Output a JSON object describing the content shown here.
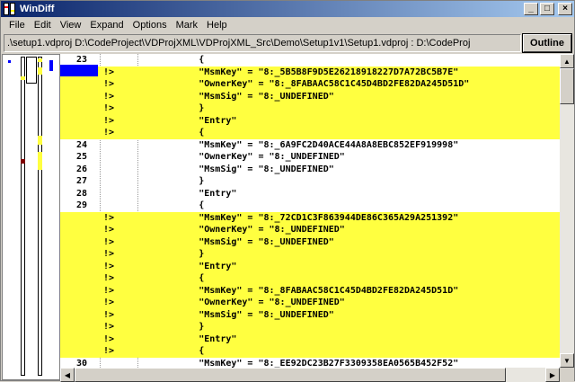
{
  "window": {
    "title": "WinDiff",
    "min_glyph": "_",
    "max_glyph": "□",
    "close_glyph": "×"
  },
  "menu": [
    "File",
    "Edit",
    "View",
    "Expand",
    "Options",
    "Mark",
    "Help"
  ],
  "toolbar": {
    "path": ".\\setup1.vdproj  D:\\CodeProject\\VDProjXML\\VDProjXML_Src\\Demo\\Setup1v1\\Setup1.vdproj : D:\\CodeProj",
    "outline_label": "Outline"
  },
  "colors": {
    "changed_bg": "#ffff40",
    "cursor": "#0000ff",
    "title_start": "#0a246a"
  },
  "rows": [
    {
      "num": "23",
      "sym": "",
      "text": "            {",
      "changed": false
    },
    {
      "num": "",
      "sym": "!>",
      "text": "            \"MsmKey\" = \"8:_5B5B8F9D5E26218918227D7A72BC5B7E\"",
      "changed": true
    },
    {
      "num": "",
      "sym": "!>",
      "text": "            \"OwnerKey\" = \"8:_8FABAAC58C1C45D4BD2FE82DA245D51D\"",
      "changed": true
    },
    {
      "num": "",
      "sym": "!>",
      "text": "            \"MsmSig\" = \"8:_UNDEFINED\"",
      "changed": true
    },
    {
      "num": "",
      "sym": "!>",
      "text": "            }",
      "changed": true
    },
    {
      "num": "",
      "sym": "!>",
      "text": "            \"Entry\"",
      "changed": true
    },
    {
      "num": "",
      "sym": "!>",
      "text": "            {",
      "changed": true
    },
    {
      "num": "24",
      "sym": "",
      "text": "            \"MsmKey\" = \"8:_6A9FC2D40ACE44A8A8EBC852EF919998\"",
      "changed": false
    },
    {
      "num": "25",
      "sym": "",
      "text": "            \"OwnerKey\" = \"8:_UNDEFINED\"",
      "changed": false
    },
    {
      "num": "26",
      "sym": "",
      "text": "            \"MsmSig\" = \"8:_UNDEFINED\"",
      "changed": false
    },
    {
      "num": "27",
      "sym": "",
      "text": "            }",
      "changed": false
    },
    {
      "num": "28",
      "sym": "",
      "text": "            \"Entry\"",
      "changed": false
    },
    {
      "num": "29",
      "sym": "",
      "text": "            {",
      "changed": false
    },
    {
      "num": "",
      "sym": "!>",
      "text": "            \"MsmKey\" = \"8:_72CD1C3F863944DE86C365A29A251392\"",
      "changed": true
    },
    {
      "num": "",
      "sym": "!>",
      "text": "            \"OwnerKey\" = \"8:_UNDEFINED\"",
      "changed": true
    },
    {
      "num": "",
      "sym": "!>",
      "text": "            \"MsmSig\" = \"8:_UNDEFINED\"",
      "changed": true
    },
    {
      "num": "",
      "sym": "!>",
      "text": "            }",
      "changed": true
    },
    {
      "num": "",
      "sym": "!>",
      "text": "            \"Entry\"",
      "changed": true
    },
    {
      "num": "",
      "sym": "!>",
      "text": "            {",
      "changed": true
    },
    {
      "num": "",
      "sym": "!>",
      "text": "            \"MsmKey\" = \"8:_8FABAAC58C1C45D4BD2FE82DA245D51D\"",
      "changed": true
    },
    {
      "num": "",
      "sym": "!>",
      "text": "            \"OwnerKey\" = \"8:_UNDEFINED\"",
      "changed": true
    },
    {
      "num": "",
      "sym": "!>",
      "text": "            \"MsmSig\" = \"8:_UNDEFINED\"",
      "changed": true
    },
    {
      "num": "",
      "sym": "!>",
      "text": "            }",
      "changed": true
    },
    {
      "num": "",
      "sym": "!>",
      "text": "            \"Entry\"",
      "changed": true
    },
    {
      "num": "",
      "sym": "!>",
      "text": "            {",
      "changed": true
    },
    {
      "num": "30",
      "sym": "",
      "text": "            \"MsmKey\" = \"8:_EE92DC23B27F3309358EA0565B452F52\"",
      "changed": false
    }
  ]
}
